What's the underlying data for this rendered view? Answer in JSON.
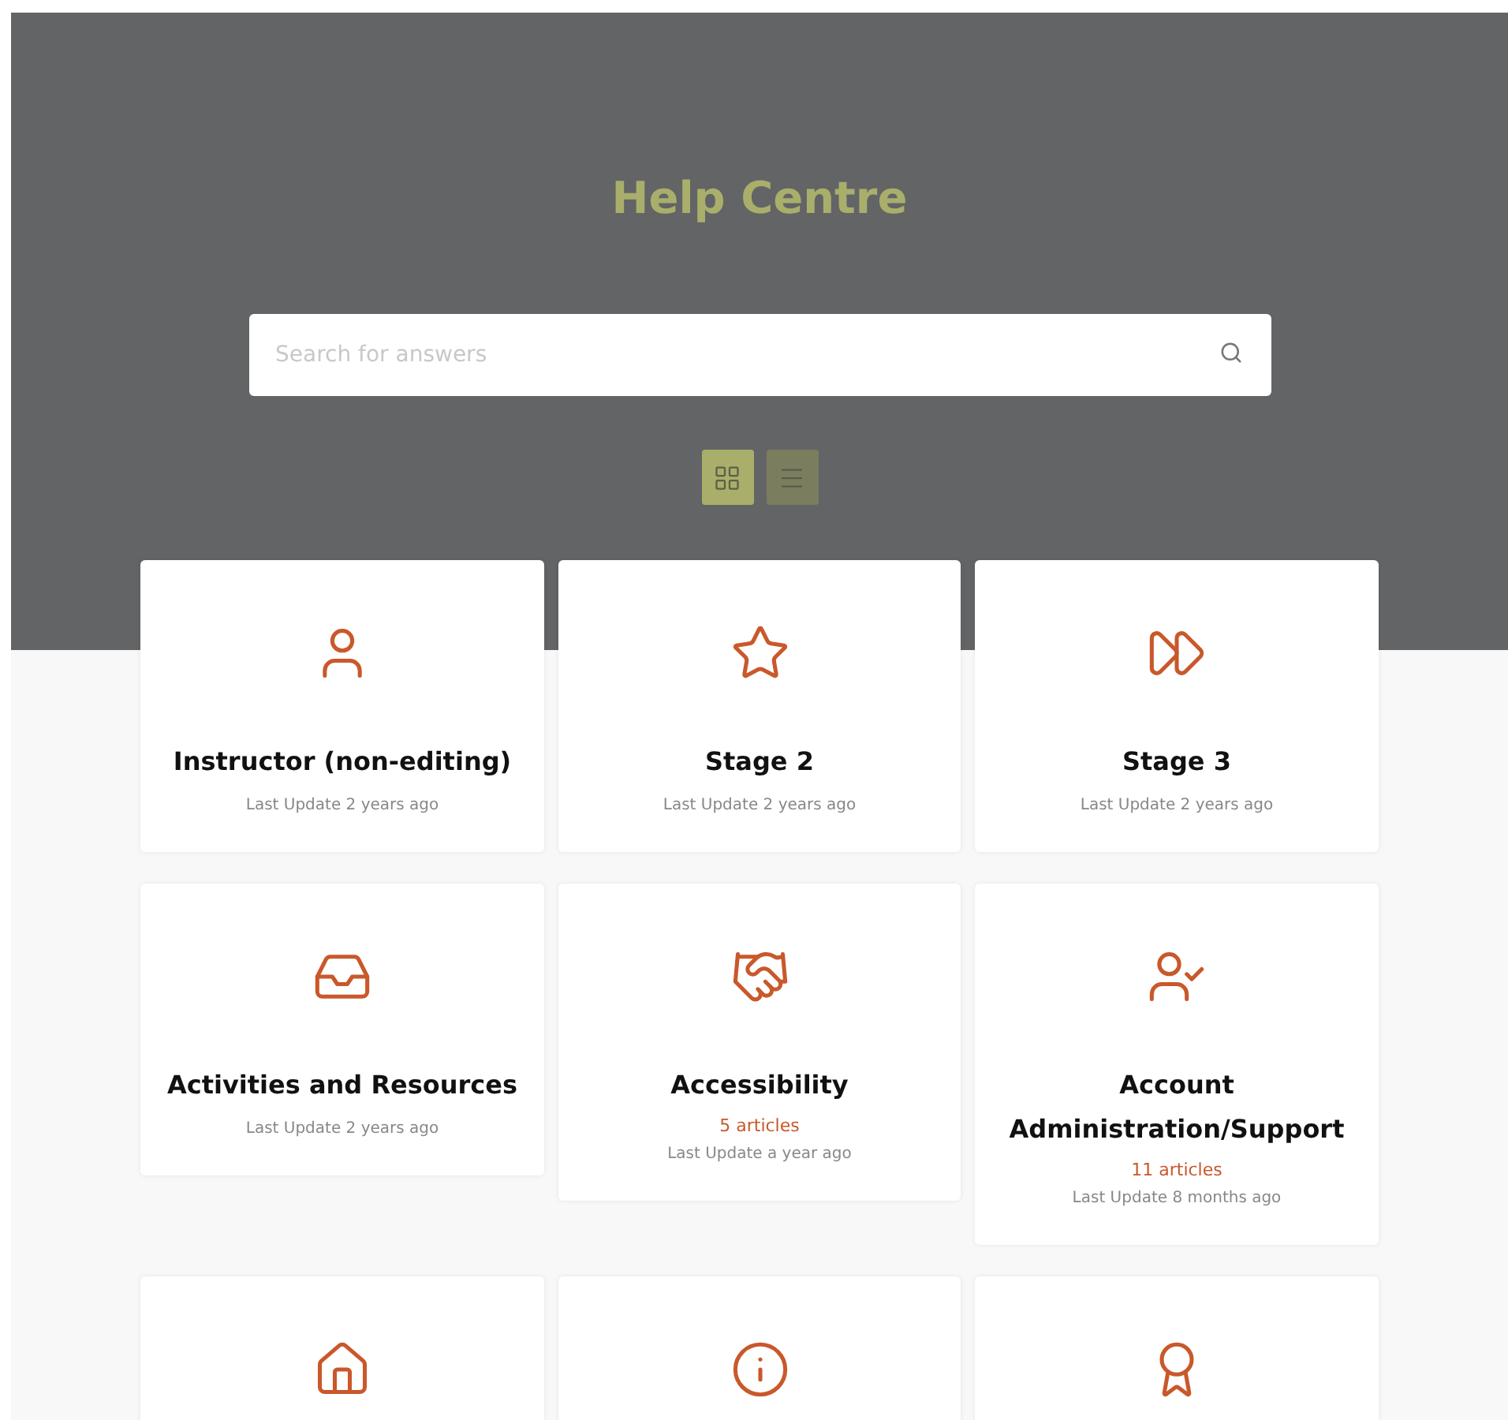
{
  "header": {
    "title": "Help Centre"
  },
  "search": {
    "placeholder": "Search for answers"
  },
  "view_toggle": [
    {
      "kind": "grid",
      "selected": true
    },
    {
      "kind": "list",
      "selected": false
    }
  ],
  "categories": [
    {
      "kind": "full",
      "title": "Instructor (non-editing)",
      "updated": "Last Update 2 years ago"
    },
    {
      "kind": "full",
      "title": "Stage 2",
      "updated": "Last Update 2 years ago"
    },
    {
      "kind": "full",
      "title": "Stage 3",
      "updated": "Last Update 2 years ago"
    },
    {
      "kind": "full",
      "title": "Activities and Resources",
      "updated": "Last Update 2 years ago"
    },
    {
      "kind": "full",
      "title": "Accessibility",
      "articles": "5 articles",
      "updated": "Last Update a year ago"
    },
    {
      "kind": "full",
      "title": "Account Administration/Support",
      "articles": "11 articles",
      "updated": "Last Update 8 months ago"
    },
    {
      "kind": "cut-off"
    },
    {
      "kind": "cut-off"
    },
    {
      "kind": "cut-off"
    }
  ]
}
